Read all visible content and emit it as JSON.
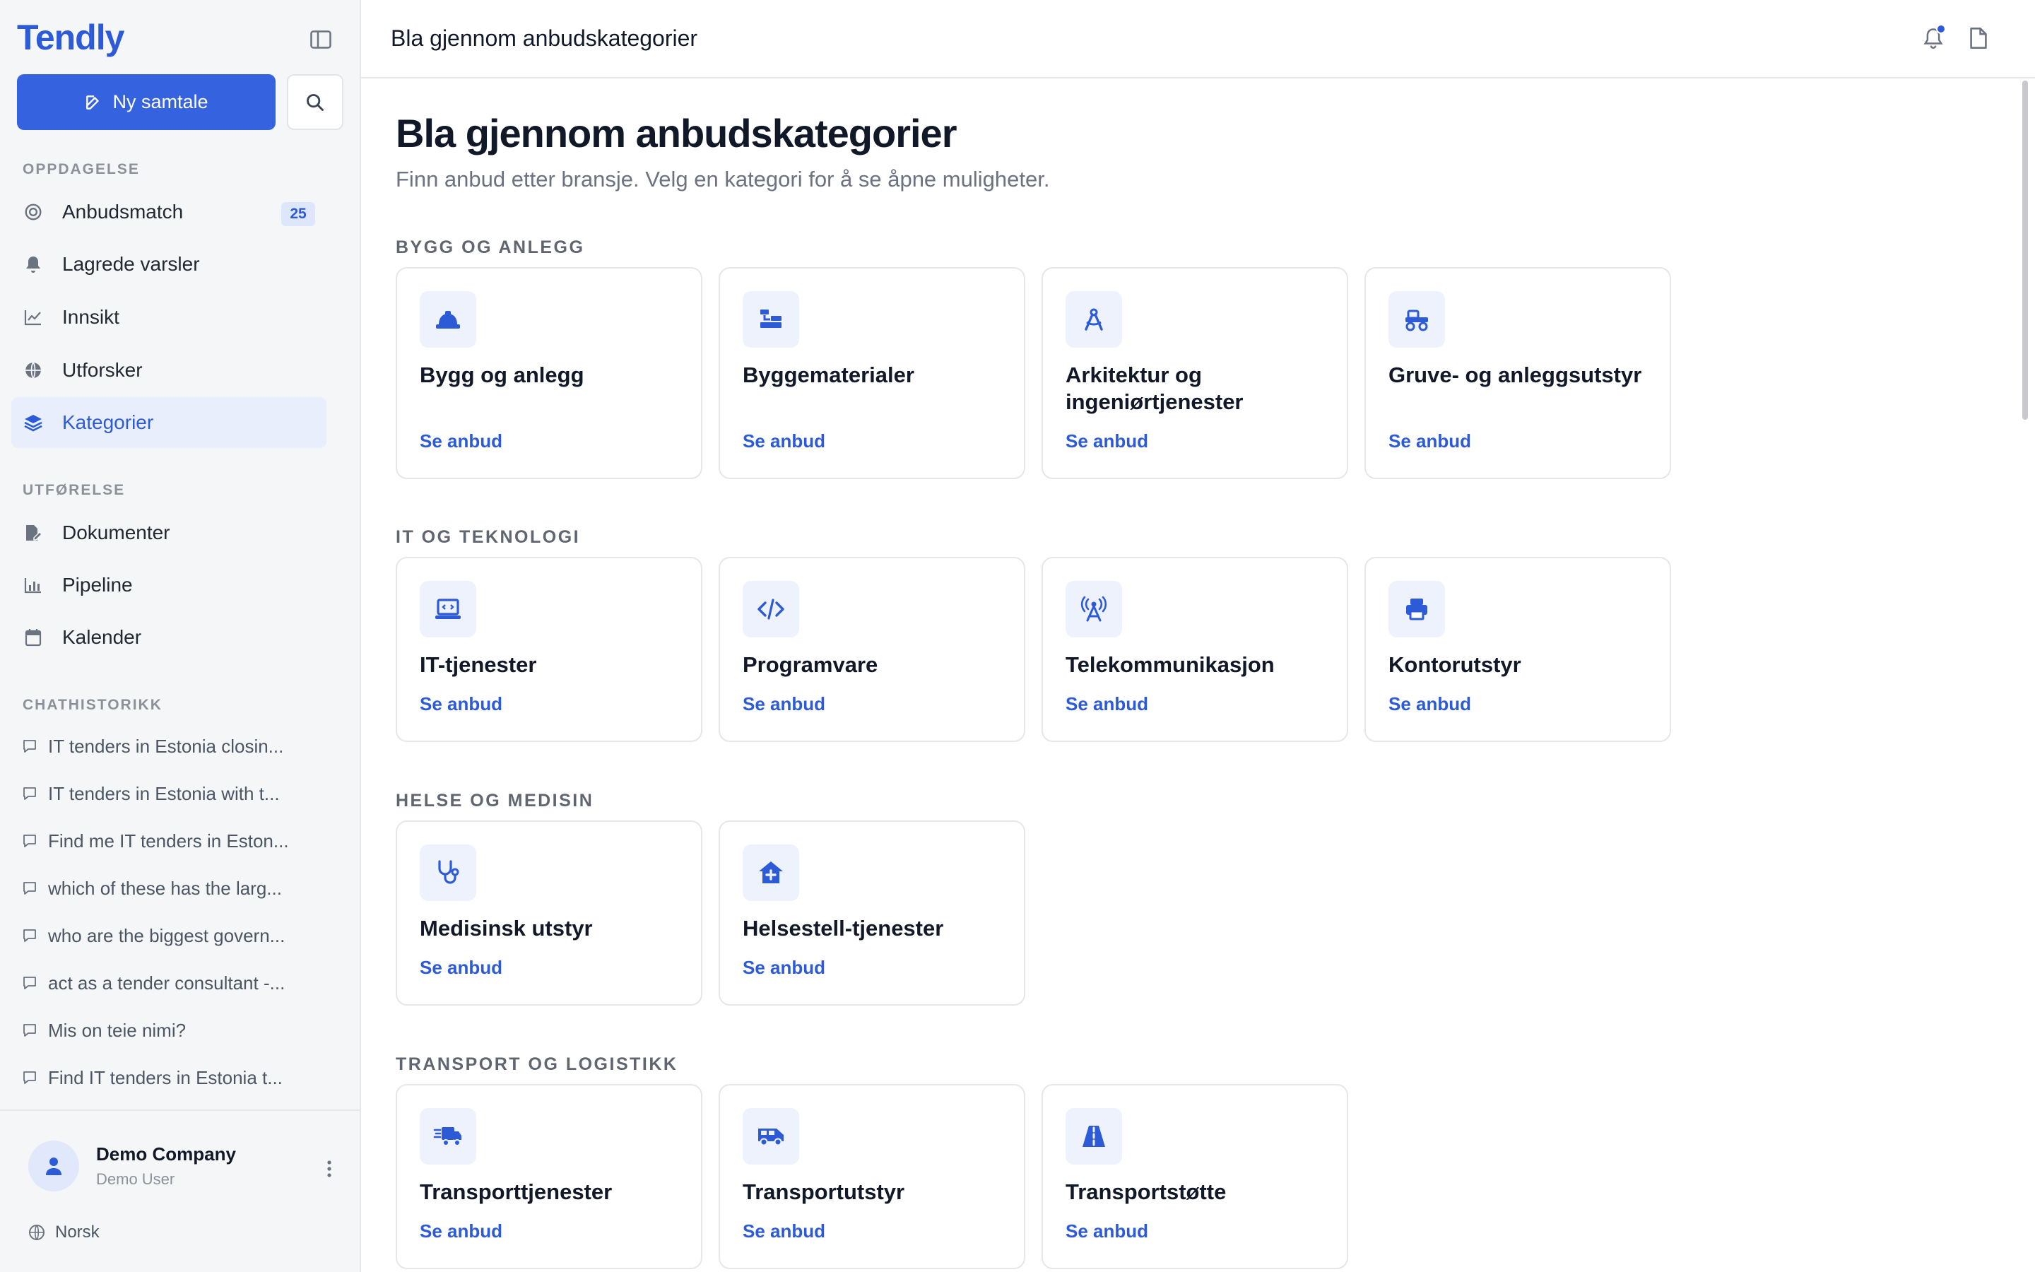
{
  "app": {
    "logo": "Tendly"
  },
  "sidebar": {
    "new_chat_label": "Ny samtale",
    "sections": {
      "discovery": "OPPDAGELSE",
      "execution": "UTFØRELSE",
      "history": "CHATHISTORIKK"
    },
    "discovery_items": [
      {
        "label": "Anbudsmatch",
        "icon": "target-icon",
        "badge": "25"
      },
      {
        "label": "Lagrede varsler",
        "icon": "bell-icon"
      },
      {
        "label": "Innsikt",
        "icon": "trend-icon"
      },
      {
        "label": "Utforsker",
        "icon": "globe-icon"
      },
      {
        "label": "Kategorier",
        "icon": "layers-icon",
        "active": true
      }
    ],
    "execution_items": [
      {
        "label": "Dokumenter",
        "icon": "document-icon"
      },
      {
        "label": "Pipeline",
        "icon": "bar-chart-icon"
      },
      {
        "label": "Kalender",
        "icon": "calendar-icon"
      }
    ],
    "chats": [
      "IT tenders in Estonia closin...",
      "IT tenders in Estonia with t...",
      "Find me IT tenders in Eston...",
      "which of these has the larg...",
      "who are the biggest govern...",
      "act as a tender consultant -...",
      "Mis on teie nimi?",
      "Find IT tenders in Estonia t..."
    ],
    "footer": {
      "company": "Demo Company",
      "user": "Demo User",
      "language": "Norsk"
    }
  },
  "header": {
    "title": "Bla gjennom anbudskategorier"
  },
  "main": {
    "title": "Bla gjennom anbudskategorier",
    "subtitle": "Finn anbud etter bransje. Velg en kategori for å se åpne muligheter.",
    "link_label": "Se anbud",
    "categories": [
      {
        "heading": "BYGG OG ANLEGG",
        "cards": [
          {
            "title": "Bygg og anlegg",
            "icon": "hard-hat-icon"
          },
          {
            "title": "Byggematerialer",
            "icon": "materials-icon"
          },
          {
            "title": "Arkitektur og ingeniørtjenester",
            "icon": "compass-icon"
          },
          {
            "title": "Gruve- og anleggsutstyr",
            "icon": "excavator-icon"
          }
        ]
      },
      {
        "heading": "IT OG TEKNOLOGI",
        "cards": [
          {
            "title": "IT-tjenester",
            "icon": "laptop-icon"
          },
          {
            "title": "Programvare",
            "icon": "code-icon"
          },
          {
            "title": "Telekommunikasjon",
            "icon": "antenna-icon"
          },
          {
            "title": "Kontorutstyr",
            "icon": "printer-icon"
          }
        ]
      },
      {
        "heading": "HELSE OG MEDISIN",
        "cards": [
          {
            "title": "Medisinsk utstyr",
            "icon": "stethoscope-icon"
          },
          {
            "title": "Helsestell-tjenester",
            "icon": "house-medical-icon"
          }
        ]
      },
      {
        "heading": "TRANSPORT OG LOGISTIKK",
        "cards": [
          {
            "title": "Transporttjenester",
            "icon": "truck-fast-icon"
          },
          {
            "title": "Transportutstyr",
            "icon": "van-icon"
          },
          {
            "title": "Transportstøtte",
            "icon": "road-icon"
          }
        ]
      }
    ]
  },
  "colors": {
    "accent": "#3563e0",
    "link": "#2d5bd8",
    "icon_bg": "#eef2fc"
  }
}
